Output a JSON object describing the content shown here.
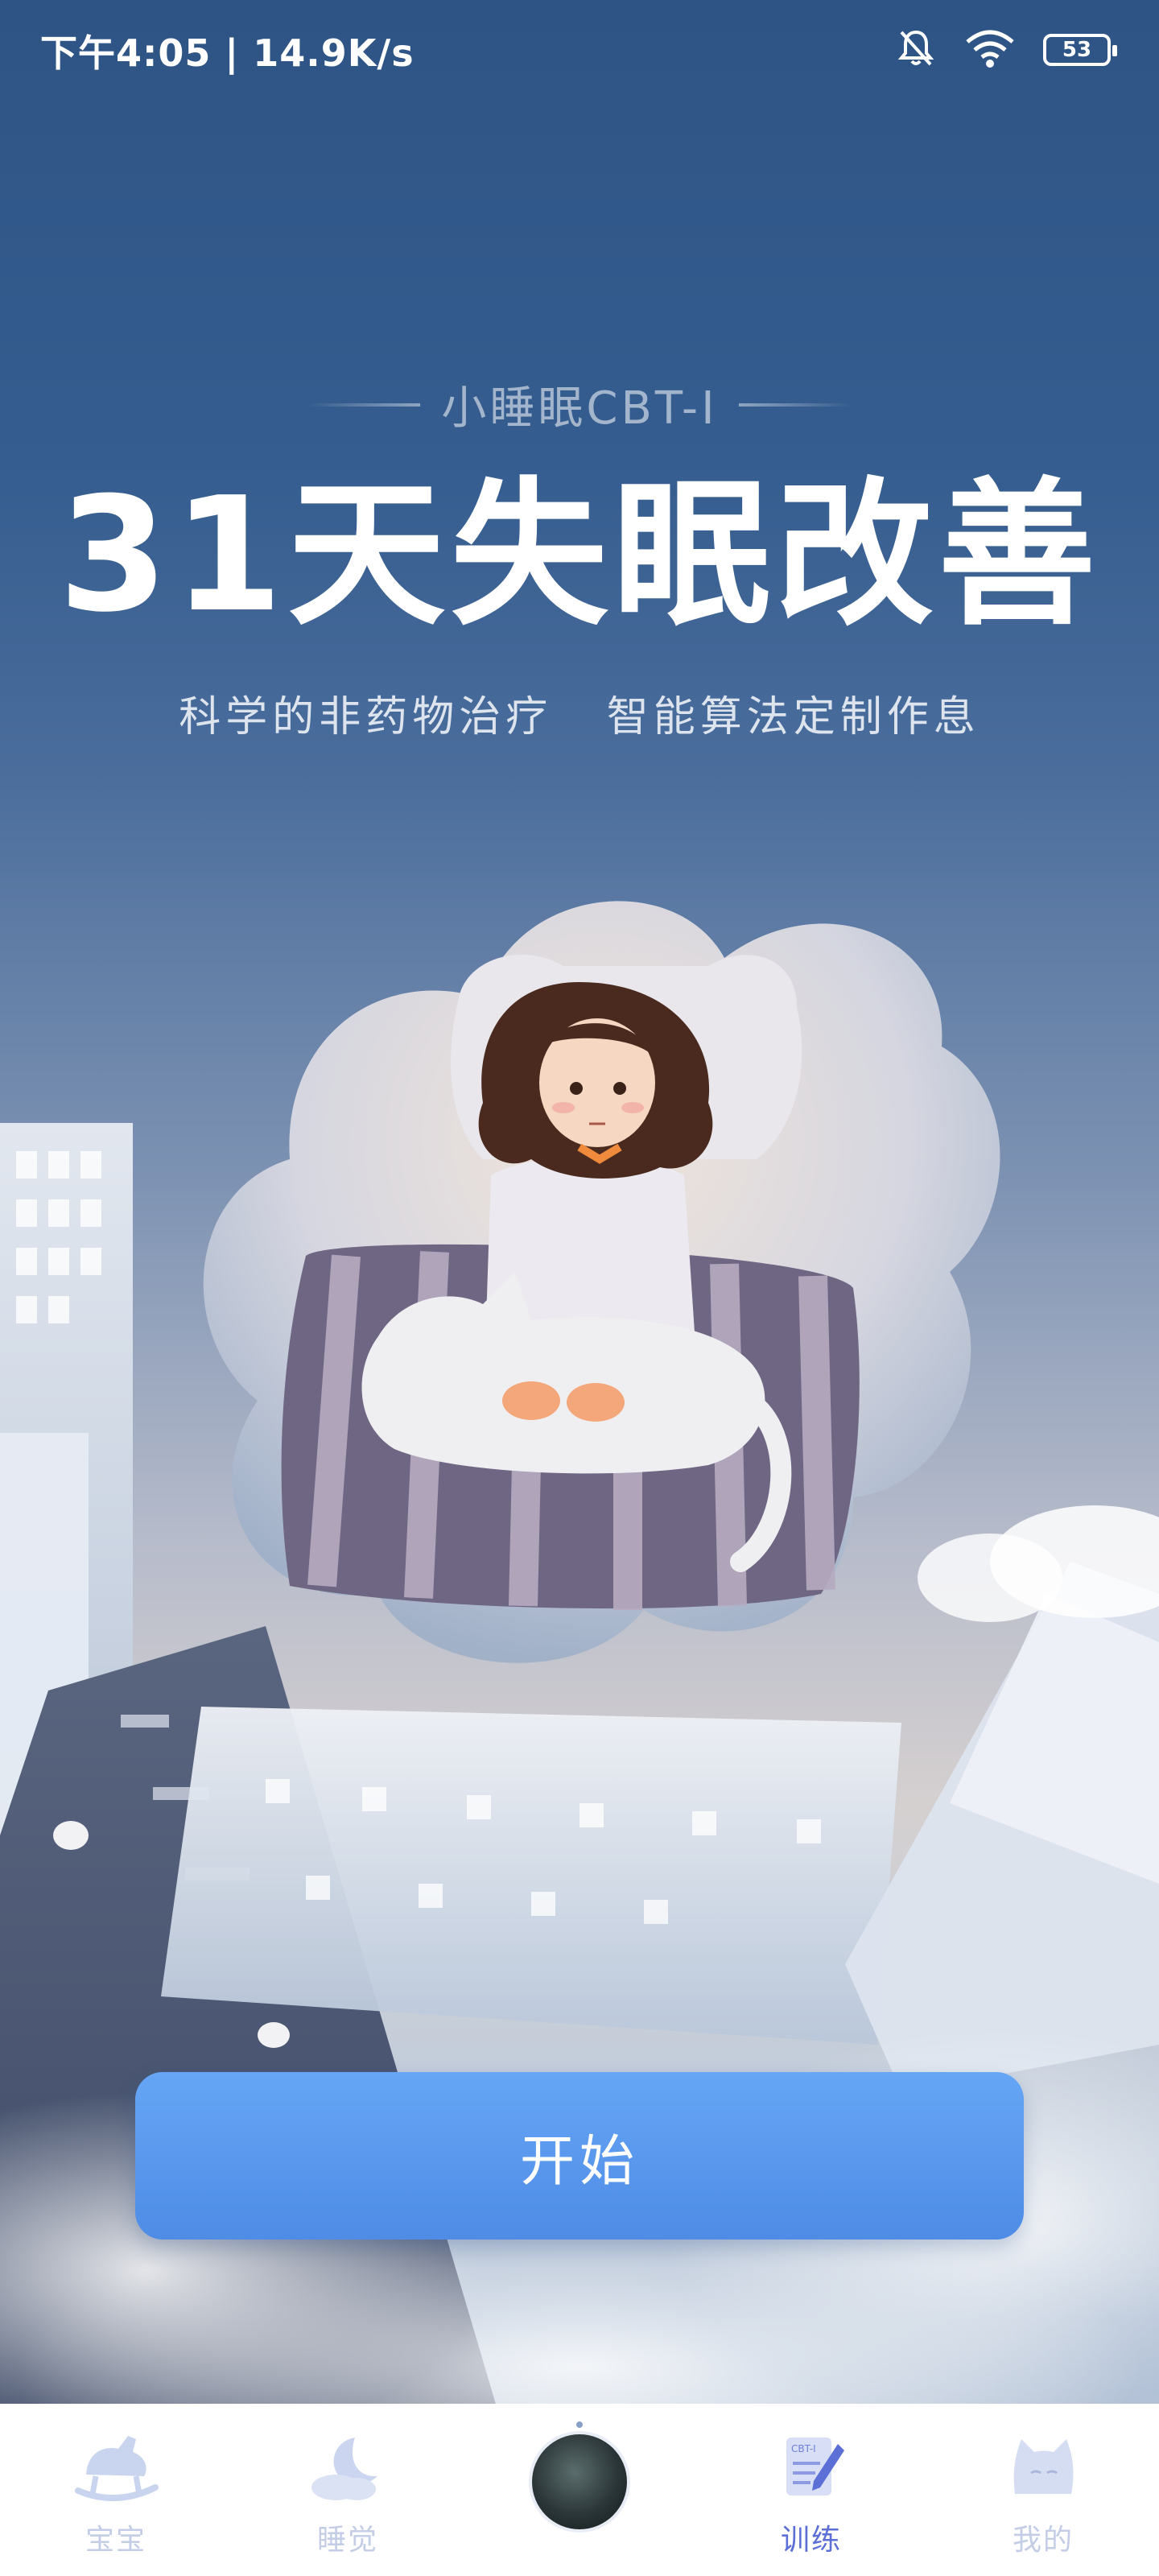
{
  "status_bar": {
    "time": "下午4:05 | 14.9K/s",
    "battery": "53"
  },
  "hero": {
    "brand": "小睡眠CBT-I",
    "headline": "31天失眠改善",
    "subline": "科学的非药物治疗   智能算法定制作息"
  },
  "start_button": {
    "label": "开始"
  },
  "bottom_nav": {
    "items": [
      {
        "label": "宝宝",
        "icon": "rocking-horse-icon"
      },
      {
        "label": "睡觉",
        "icon": "moon-cloud-icon"
      },
      {
        "label": "",
        "icon": "album-cover-icon"
      },
      {
        "label": "训练",
        "icon": "cbt-notebook-icon",
        "active": true
      },
      {
        "label": "我的",
        "icon": "cat-profile-icon"
      }
    ]
  },
  "colors": {
    "accent": "#5b6fd6",
    "button": "#5a98ee",
    "nav_inactive": "#c3cde6"
  }
}
